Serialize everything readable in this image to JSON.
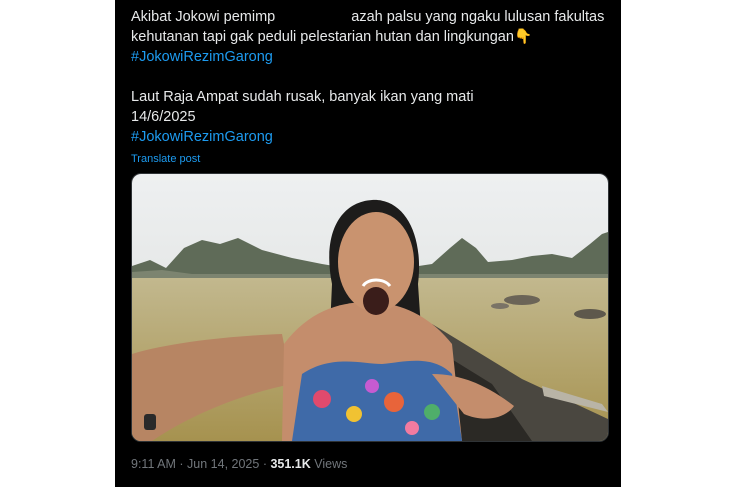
{
  "post": {
    "line1_start": "Akibat Jokowi pemimp",
    "line1_end": "azah palsu yang ngaku lulusan fakultas",
    "line2": "kehutanan tapi gak peduli pelestarian hutan dan lingkungan",
    "line2_emoji": "👇",
    "hashtag1": "#JokowiRezimGarong",
    "line3": "Laut Raja Ampat sudah rusak, banyak ikan yang mati",
    "date_line": "14/6/2025",
    "hashtag2": "#JokowiRezimGarong",
    "translate_label": "Translate post"
  },
  "meta": {
    "time": "9:11 AM",
    "separator": " · ",
    "date": "Jun 14, 2025",
    "views_count": "351.1K",
    "views_label": "Views"
  }
}
